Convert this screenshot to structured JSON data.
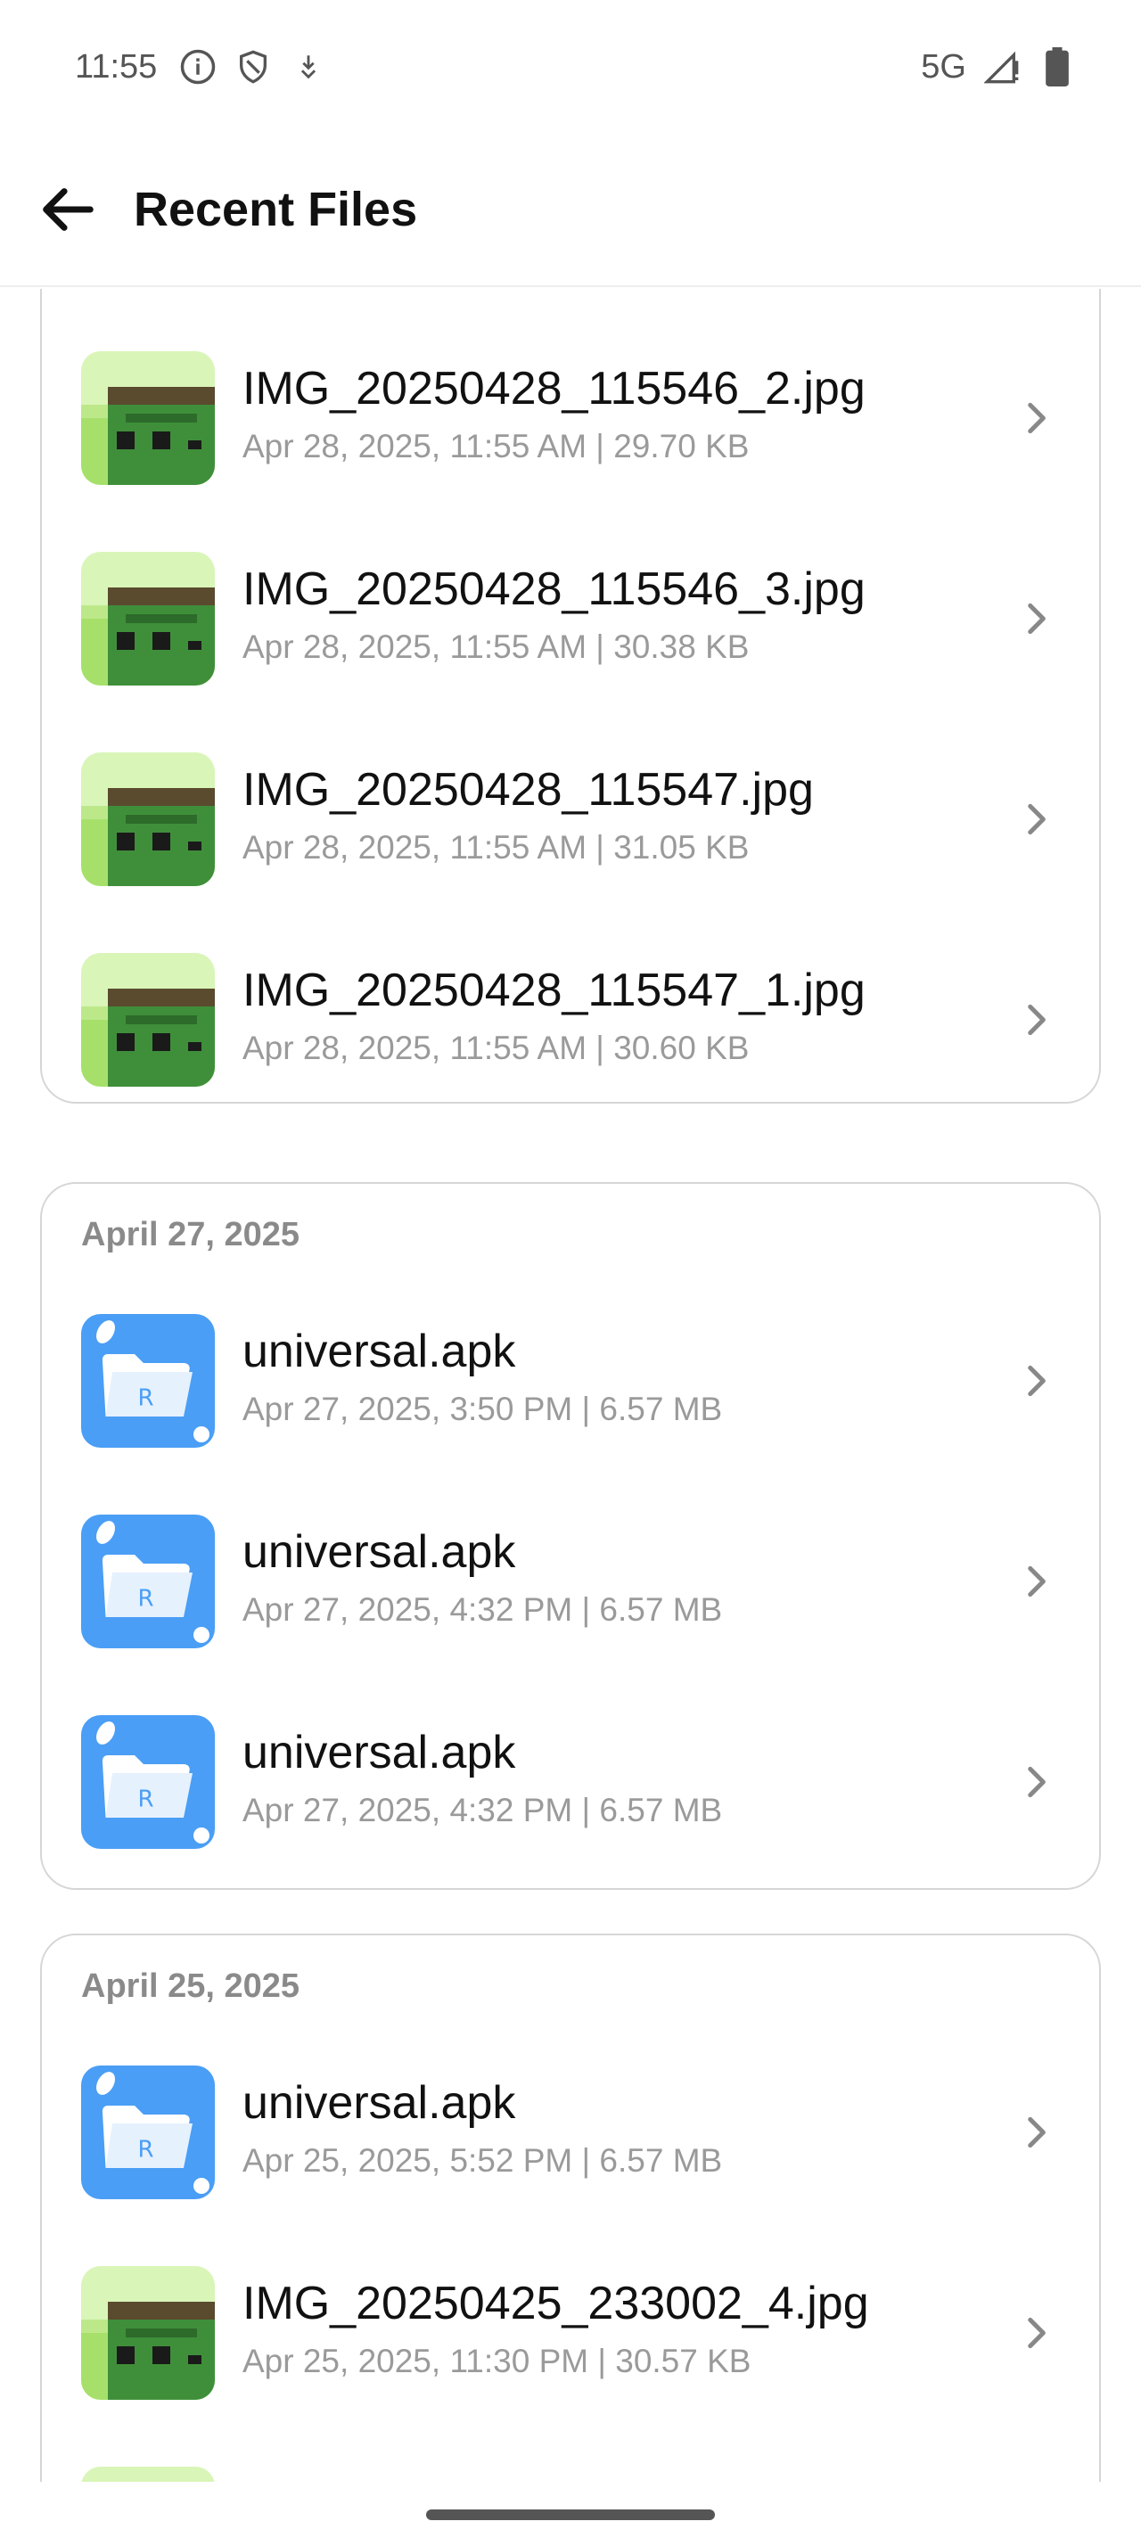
{
  "status_bar": {
    "time": "11:55",
    "network": "5G",
    "icons": [
      "info-icon",
      "shield-icon",
      "download-icon",
      "signal-icon",
      "battery-icon"
    ]
  },
  "header": {
    "title": "Recent Files",
    "back_icon": "arrow-left-icon"
  },
  "groups": [
    {
      "date": "",
      "items": [
        {
          "name": "IMG_20250428_115546_2.jpg",
          "meta": "Apr 28, 2025, 11:55 AM  | 29.70 KB",
          "type": "image"
        },
        {
          "name": "IMG_20250428_115546_3.jpg",
          "meta": "Apr 28, 2025, 11:55 AM  | 30.38 KB",
          "type": "image"
        },
        {
          "name": "IMG_20250428_115547.jpg",
          "meta": "Apr 28, 2025, 11:55 AM  | 31.05 KB",
          "type": "image"
        },
        {
          "name": "IMG_20250428_115547_1.jpg",
          "meta": "Apr 28, 2025, 11:55 AM  | 30.60 KB",
          "type": "image"
        }
      ]
    },
    {
      "date": "April 27, 2025",
      "items": [
        {
          "name": "universal.apk",
          "meta": "Apr 27, 2025, 3:50 PM  | 6.57 MB",
          "type": "apk"
        },
        {
          "name": "universal.apk",
          "meta": "Apr 27, 2025, 4:32 PM  | 6.57 MB",
          "type": "apk"
        },
        {
          "name": "universal.apk",
          "meta": "Apr 27, 2025, 4:32 PM  | 6.57 MB",
          "type": "apk"
        }
      ]
    },
    {
      "date": "April 25, 2025",
      "items": [
        {
          "name": "universal.apk",
          "meta": "Apr 25, 2025, 5:52 PM  | 6.57 MB",
          "type": "apk"
        },
        {
          "name": "IMG_20250425_233002_4.jpg",
          "meta": "Apr 25, 2025, 11:30 PM  | 30.57 KB",
          "type": "image"
        }
      ]
    }
  ],
  "colors": {
    "apk_icon_bg": "#4a9ef5",
    "image_light_green": "#d9f5b8",
    "image_green": "#3f8f3a",
    "meta_text": "#9a9a9a",
    "group_border": "#d6d6d6"
  }
}
